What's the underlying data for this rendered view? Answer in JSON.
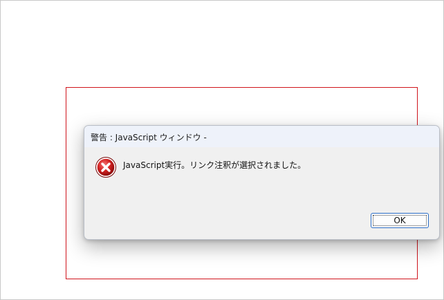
{
  "dialog": {
    "title": "警告 : JavaScript ウィンドウ -",
    "message": "JavaScript実行。リンク注釈が選択されました。",
    "ok_label": "OK",
    "icon": "error-icon"
  },
  "colors": {
    "highlight_border": "#d0141c",
    "focus_border": "#2b6cc4",
    "dialog_background": "#f0f0f0",
    "titlebar_background": "#eef2fa"
  }
}
